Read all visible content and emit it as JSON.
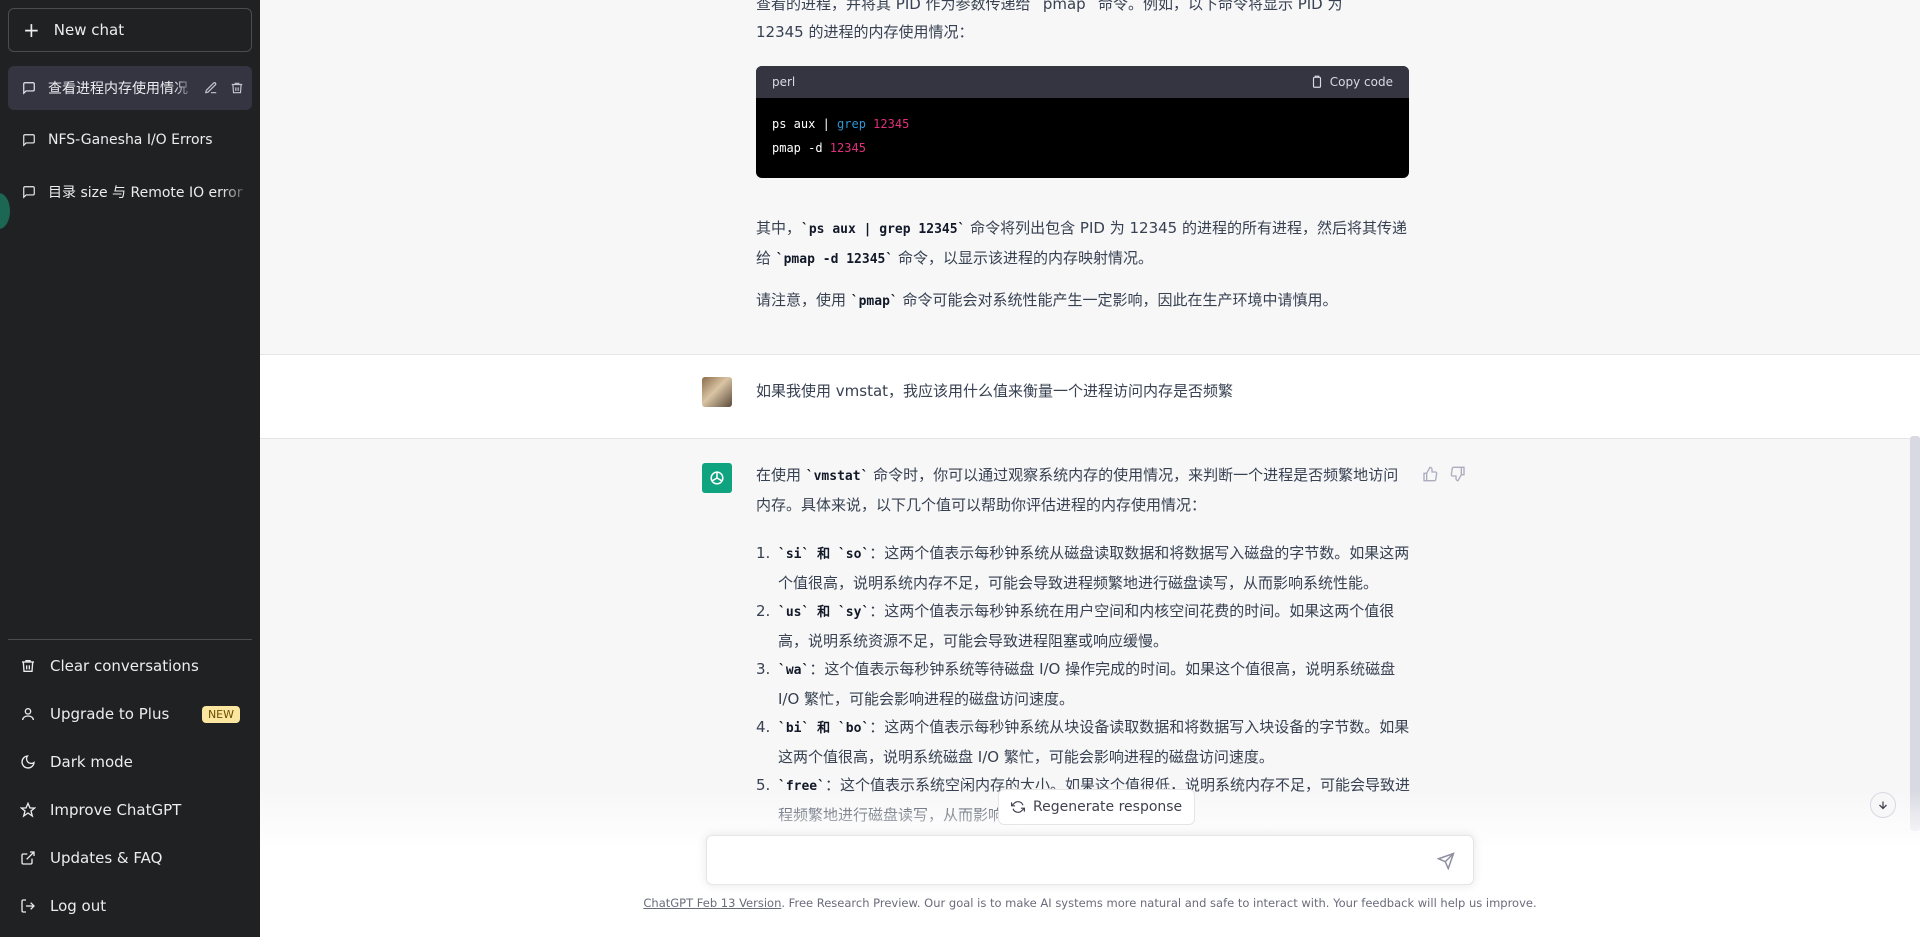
{
  "sidebar": {
    "new_chat": "New chat",
    "conversations": [
      {
        "label": "查看进程内存使用情况"
      },
      {
        "label": "NFS-Ganesha I/O Errors"
      },
      {
        "label": "目录 size 与 Remote IO error"
      }
    ],
    "menu": [
      {
        "label": "Clear conversations",
        "icon": "trash-icon"
      },
      {
        "label": "Upgrade to Plus",
        "icon": "user-icon",
        "badge": "NEW"
      },
      {
        "label": "Dark mode",
        "icon": "moon-icon"
      },
      {
        "label": "Improve ChatGPT",
        "icon": "star-icon"
      },
      {
        "label": "Updates & FAQ",
        "icon": "external-link-icon"
      },
      {
        "label": "Log out",
        "icon": "logout-icon"
      }
    ]
  },
  "thread": {
    "prev_answer": {
      "intro_line1": "查看的进程，并将其 PID 作为参数传递给 `pmap` 命令。例如，以下命令将显示 PID 为",
      "intro_line2": "12345 的进程的内存使用情况：",
      "code": {
        "lang": "perl",
        "copy_label": "Copy code",
        "line1_cmd": "ps aux | ",
        "line1_kw": "grep",
        "line1_num": "12345",
        "line2_cmd": "pmap -d ",
        "line2_num": "12345"
      },
      "p1_a": "其中，",
      "p1_code1": "`ps aux | grep 12345`",
      "p1_b": " 命令将列出包含 PID 为 12345 的进程的所有进程，然后将其",
      "p1_c": "传递给 ",
      "p1_code2": "`pmap -d 12345`",
      "p1_d": " 命令，以显示该进程的内存映射情况。",
      "p2_a": "请注意，使用 ",
      "p2_code": "`pmap`",
      "p2_b": " 命令可能会对系统性能产生一定影响，因此在生产环境中请慎用。"
    },
    "user_message": "如果我使用 vmstat，我应该用什么值来衡量一个进程访问内存是否频繁",
    "answer": {
      "intro_a": "在使用 ",
      "intro_code": "`vmstat`",
      "intro_b": " 命令时，你可以通过观察系统内存的使用情况，来判断一个进程是否频繁地",
      "intro_c": "访问内存。具体来说，以下几个值可以帮助你评估进程的内存使用情况：",
      "items": [
        {
          "n": "1.",
          "code": "`si` 和 `so`",
          "text": "：这两个值表示每秒钟系统从磁盘读取数据和将数据写入磁盘的字节数。如果这两个值很高，说明系统内存不足，可能会导致进程频繁地进行磁盘读写，从而影响系统性能。"
        },
        {
          "n": "2.",
          "code": "`us` 和 `sy`",
          "text": "：这两个值表示每秒钟系统在用户空间和内核空间花费的时间。如果这两个值很高，说明系统资源不足，可能会导致进程阻塞或响应缓慢。"
        },
        {
          "n": "3.",
          "code": "`wa`",
          "text": "：这个值表示每秒钟系统等待磁盘 I/O 操作完成的时间。如果这个值很高，说明系统磁盘 I/O 繁忙，可能会影响进程的磁盘访问速度。"
        },
        {
          "n": "4.",
          "code": "`bi` 和 `bo`",
          "text": "：这两个值表示每秒钟系统从块设备读取数据和将数据写入块设备的字节数。如果这两个值很高，说明系统磁盘 I/O 繁忙，可能会影响进程的磁盘访问速度。"
        },
        {
          "n": "5.",
          "code": "`free`",
          "text": "：这个值表示系统空闲内存的大小。如果这个值很低，说明系统内存不足，可能会导致进程频繁地进行磁盘读写，从而影响系统性能。"
        }
      ]
    }
  },
  "regenerate_label": "Regenerate response",
  "input": {
    "placeholder": ""
  },
  "footer": {
    "link": "ChatGPT Feb 13 Version",
    "text": ". Free Research Preview. Our goal is to make AI systems more natural and safe to interact with. Your feedback will help us improve."
  },
  "colors": {
    "sidebar_bg": "#202123",
    "assistant_bg": "#f7f7f8",
    "assistant_avatar": "#10a37f",
    "new_badge": "#fae69e"
  }
}
